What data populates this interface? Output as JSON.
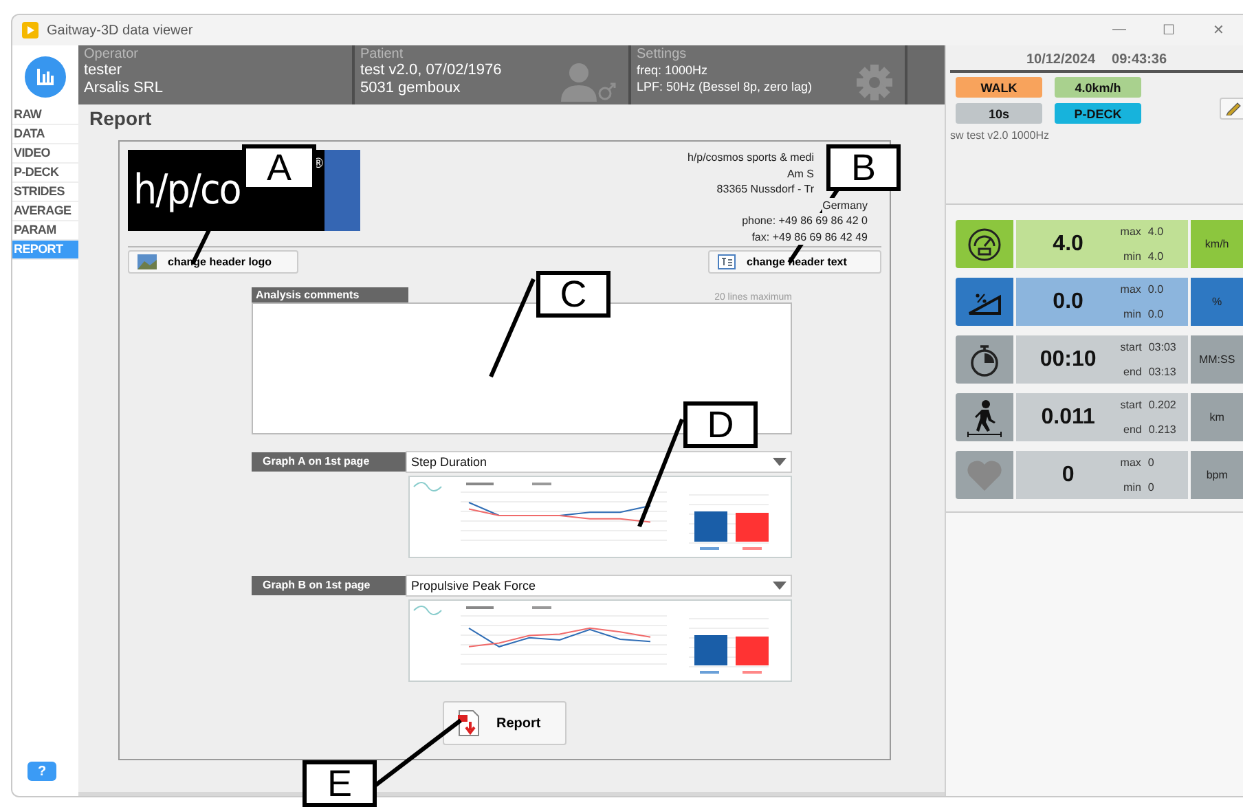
{
  "window": {
    "title": "Gaitway-3D data viewer",
    "controls": [
      "—",
      "☐",
      "✕"
    ]
  },
  "nav": {
    "items": [
      {
        "label": "RAW",
        "selected": false
      },
      {
        "label": "DATA",
        "selected": false
      },
      {
        "label": "VIDEO",
        "selected": false
      },
      {
        "label": "P-DECK",
        "selected": false
      },
      {
        "label": "STRIDES",
        "selected": false
      },
      {
        "label": "AVERAGE",
        "selected": false
      },
      {
        "label": "PARAM",
        "selected": false
      },
      {
        "label": "REPORT",
        "selected": true
      }
    ],
    "help": "?"
  },
  "header": {
    "sections": [
      {
        "kind": "operator",
        "title": "Operator",
        "lines": [
          "tester",
          "Arsalis SRL"
        ]
      },
      {
        "kind": "patient",
        "title": "Patient",
        "lines": [
          "test v2.0, 07/02/1976",
          "5031 gemboux"
        ]
      },
      {
        "kind": "settings",
        "title": "Settings",
        "lines": [
          "freq: 1000Hz",
          "LPF: 50Hz (Bessel 8p, zero lag)"
        ]
      }
    ]
  },
  "page": {
    "title": "Report"
  },
  "report_header": {
    "logo_text": "h/p/co",
    "logo_mark": "®",
    "address_lines": [
      {
        "text": "h/p/cosmos sports & medi",
        "covered": true
      },
      {
        "text": "Am S",
        "covered": true
      },
      {
        "text": "83365 Nussdorf - Tr",
        "covered": true
      },
      {
        "text": "Germany",
        "covered": false
      },
      {
        "text": "phone: +49 86 69 86 42 0",
        "covered": false
      },
      {
        "text": "fax: +49 86 69 86 42 49",
        "covered": false
      }
    ],
    "logo_button": "change header logo",
    "text_button": "change header text"
  },
  "comments": {
    "label": "Analysis comments",
    "hint": "20 lines maximum"
  },
  "graphs": [
    {
      "label": "Graph A on 1st page",
      "value": "Step Duration"
    },
    {
      "label": "Graph B on 1st page",
      "value": "Propulsive Peak Force"
    }
  ],
  "report_button": "Report",
  "status": {
    "date": "10/12/2024",
    "time": "09:43:36",
    "chips": [
      {
        "label": "WALK",
        "color": "#f8a35c"
      },
      {
        "label": "4.0km/h",
        "color": "#a9d18e"
      },
      {
        "label": "10s",
        "color": "#bfc5c8"
      },
      {
        "label": "P-DECK",
        "color": "#17b3dc"
      }
    ],
    "note": "sw test v2.0 1000Hz"
  },
  "metrics": [
    {
      "kind": "speed",
      "color": "#8cc63e",
      "value": "4.0",
      "stats": [
        {
          "label": "max",
          "value": "4.0"
        },
        {
          "label": "min",
          "value": "4.0"
        }
      ],
      "unit": "km/h"
    },
    {
      "kind": "incline",
      "color": "#2e78c2",
      "value": "0.0",
      "stats": [
        {
          "label": "max",
          "value": "0.0"
        },
        {
          "label": "min",
          "value": "0.0"
        }
      ],
      "unit": "%"
    },
    {
      "kind": "time",
      "color": "#9aa3a7",
      "value": "00:10",
      "stats": [
        {
          "label": "start",
          "value": "03:03"
        },
        {
          "label": "end",
          "value": "03:13"
        }
      ],
      "unit": "MM:SS"
    },
    {
      "kind": "distance",
      "color": "#9aa3a7",
      "value": "0.011",
      "stats": [
        {
          "label": "start",
          "value": "0.202"
        },
        {
          "label": "end",
          "value": "0.213"
        }
      ],
      "unit": "km"
    },
    {
      "kind": "heart",
      "color": "#9aa3a7",
      "value": "0",
      "stats": [
        {
          "label": "max",
          "value": "0"
        },
        {
          "label": "min",
          "value": "0"
        }
      ],
      "unit": "bpm"
    }
  ],
  "callouts": [
    {
      "label": "A"
    },
    {
      "label": "B"
    },
    {
      "label": "C"
    },
    {
      "label": "D"
    },
    {
      "label": "E"
    }
  ]
}
